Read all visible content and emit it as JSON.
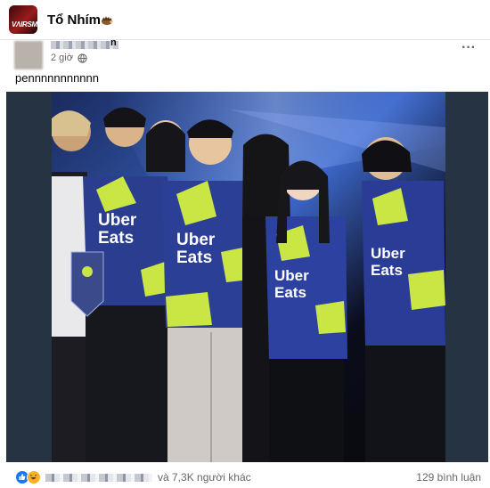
{
  "group": {
    "name": "Tổ Nhím",
    "avatar_text": "VΛIRSM",
    "badge_icon": "hedgehog-icon"
  },
  "post": {
    "author_visible_suffix": "n",
    "time": "2 giờ",
    "separator": "·",
    "privacy_icon": "globe-icon",
    "more_label": "···",
    "text": "pennnnnnnnnnn"
  },
  "media": {
    "description_icon": "photo",
    "jersey_text": "Uber Eats"
  },
  "reactions": {
    "icons": [
      "like-icon",
      "haha-icon"
    ],
    "summary": "và 7,3K người khác",
    "comments": "129 bình luận"
  },
  "colors": {
    "facebook_blue": "#1877f2",
    "secondary_text": "#65676b",
    "haha_yellow": "#f7b125"
  }
}
